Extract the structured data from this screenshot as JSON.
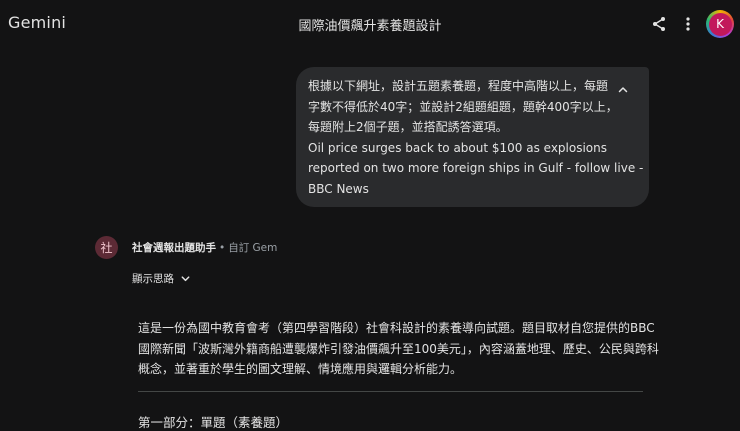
{
  "header": {
    "brand": "Gemini",
    "chat_title": "國際油價飆升素養題設計",
    "share_icon": "share-icon",
    "more_icon": "more-vert-icon",
    "user_initial": "K"
  },
  "user_message": {
    "lines": [
      "根據以下網址，設計五題素養題，程度中高階以上，每題",
      "字數不得低於40字；並設計2組題組題，題幹400字以上，",
      "每題附上2個子題，並搭配誘答選項。",
      "Oil price surges back to about $100 as explosions",
      "reported on two more foreign ships in Gulf - follow live -",
      "BBC News"
    ],
    "collapse_icon": "chevron-up-icon"
  },
  "model": {
    "avatar_char": "社",
    "name": "社會週報出題助手",
    "separator": "•",
    "subtitle": "自訂 Gem",
    "show_thinking": "顯示思路",
    "response_lines": [
      "這是一份為國中教育會考（第四學習階段）社會科設計的素養導向試題。題目取材自您提供的BBC",
      "國際新聞「波斯灣外籍商船遭襲爆炸引發油價飆升至100美元」，內容涵蓋地理、歷史、公民與跨科",
      "概念，並著重於學生的圖文理解、情境應用與邏輯分析能力。"
    ],
    "section_heading": "第一部分：單題（素養題）"
  },
  "colors": {
    "background": "#131314",
    "bubble": "#2a2b2d",
    "text": "#e3e3e3",
    "muted": "#9aa0a6",
    "avatar_pink": "#c2185b",
    "gem_avatar": "#5c2a35"
  }
}
